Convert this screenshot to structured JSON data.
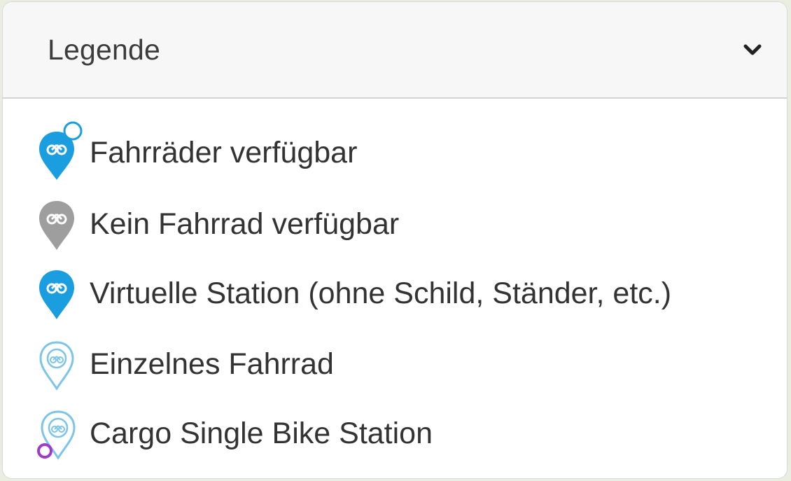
{
  "legend": {
    "title": "Legende",
    "items": [
      {
        "label": "Fahrräder verfügbar",
        "icon": "blue-pin-with-counter-icon",
        "color": "#1a9ee0"
      },
      {
        "label": "Kein Fahrrad verfügbar",
        "icon": "grey-pin-icon",
        "color": "#9e9e9e"
      },
      {
        "label": "Virtuelle Station (ohne Schild, Ständer, etc.)",
        "icon": "blue-pin-icon",
        "color": "#1a9ee0"
      },
      {
        "label": "Einzelnes Fahrrad",
        "icon": "outline-pin-icon",
        "color": "#7cc4e8"
      },
      {
        "label": "Cargo Single Bike Station",
        "icon": "outline-pin-cargo-icon",
        "color": "#a238c9"
      }
    ]
  }
}
